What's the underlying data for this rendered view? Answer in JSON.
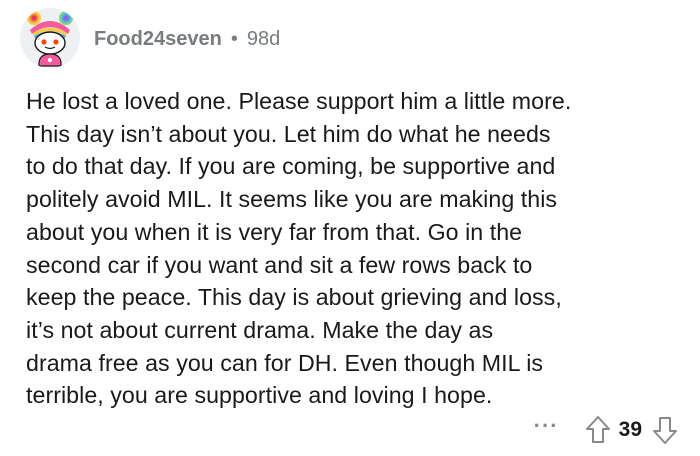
{
  "comment": {
    "author": "Food24seven",
    "separator": "•",
    "age": "98d",
    "avatar": "snoo-avatar-rainbow-hair-pink-outfit",
    "body": "He lost a loved one. Please support him a little more.\nThis day isn’t about you. Let him do what he needs\nto do that day. If you are coming, be supportive and\npolitely avoid MIL. It seems like you are making this\nabout you when it is very far from that. Go in the\nsecond car if you want and sit a few rows back to\nkeep the peace. This day is about grieving and loss,\nit’s not about current drama.  Make the day as\ndrama free as you can for DH. Even though MIL is\nterrible, you are supportive and loving I hope.",
    "actions": {
      "more_label": "···",
      "upvote_icon": "upvote-arrow-icon",
      "score": "39",
      "downvote_icon": "downvote-arrow-icon"
    }
  },
  "colors": {
    "text": "#1a1a1b",
    "meta": "#787c7e",
    "icon": "#878a8c",
    "background": "#ffffff"
  }
}
